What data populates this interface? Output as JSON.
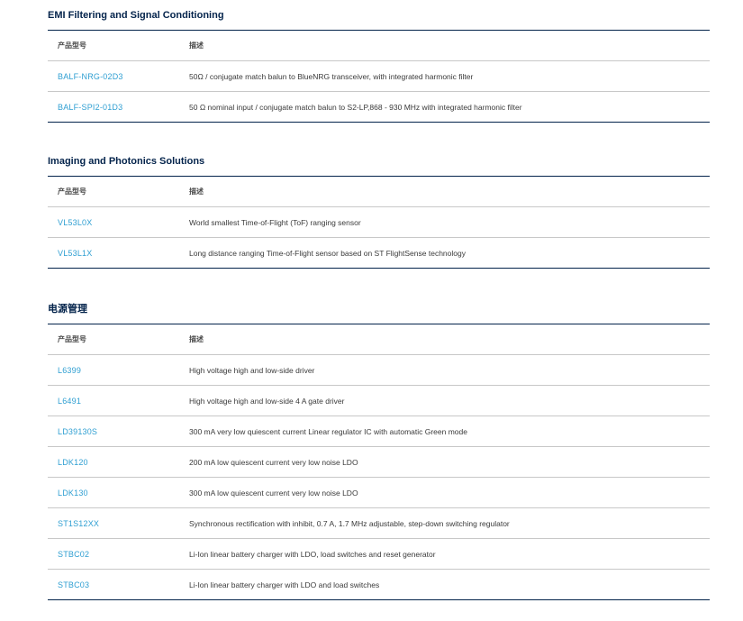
{
  "sections": [
    {
      "title": "EMI Filtering and Signal Conditioning",
      "header": {
        "part": "产品型号",
        "desc": "描述"
      },
      "rows": [
        {
          "part": "BALF-NRG-02D3",
          "desc": "50Ω / conjugate match balun to BlueNRG transceiver, with integrated harmonic filter"
        },
        {
          "part": "BALF-SPI2-01D3",
          "desc": "50 Ω nominal input / conjugate match balun to S2-LP,868 - 930 MHz with integrated harmonic filter"
        }
      ]
    },
    {
      "title": "Imaging and Photonics Solutions",
      "header": {
        "part": "产品型号",
        "desc": "描述"
      },
      "rows": [
        {
          "part": "VL53L0X",
          "desc": "World smallest Time-of-Flight (ToF) ranging sensor"
        },
        {
          "part": "VL53L1X",
          "desc": "Long distance ranging Time-of-Flight sensor based on ST FlightSense technology"
        }
      ]
    },
    {
      "title": "电源管理",
      "header": {
        "part": "产品型号",
        "desc": "描述"
      },
      "rows": [
        {
          "part": "L6399",
          "desc": "High voltage high and low-side driver"
        },
        {
          "part": "L6491",
          "desc": "High voltage high and low-side 4 A gate driver"
        },
        {
          "part": "LD39130S",
          "desc": "300 mA very low quiescent current Linear regulator IC with automatic Green mode"
        },
        {
          "part": "LDK120",
          "desc": "200 mA low quiescent current very low noise LDO"
        },
        {
          "part": "LDK130",
          "desc": "300 mA low quiescent current very low noise LDO"
        },
        {
          "part": "ST1S12XX",
          "desc": "Synchronous rectification with inhibit, 0.7 A, 1.7 MHz adjustable, step-down switching regulator"
        },
        {
          "part": "STBC02",
          "desc": "Li-Ion linear battery charger with LDO, load switches and reset generator"
        },
        {
          "part": "STBC03",
          "desc": "Li-Ion linear battery charger with LDO and load switches"
        }
      ]
    }
  ]
}
